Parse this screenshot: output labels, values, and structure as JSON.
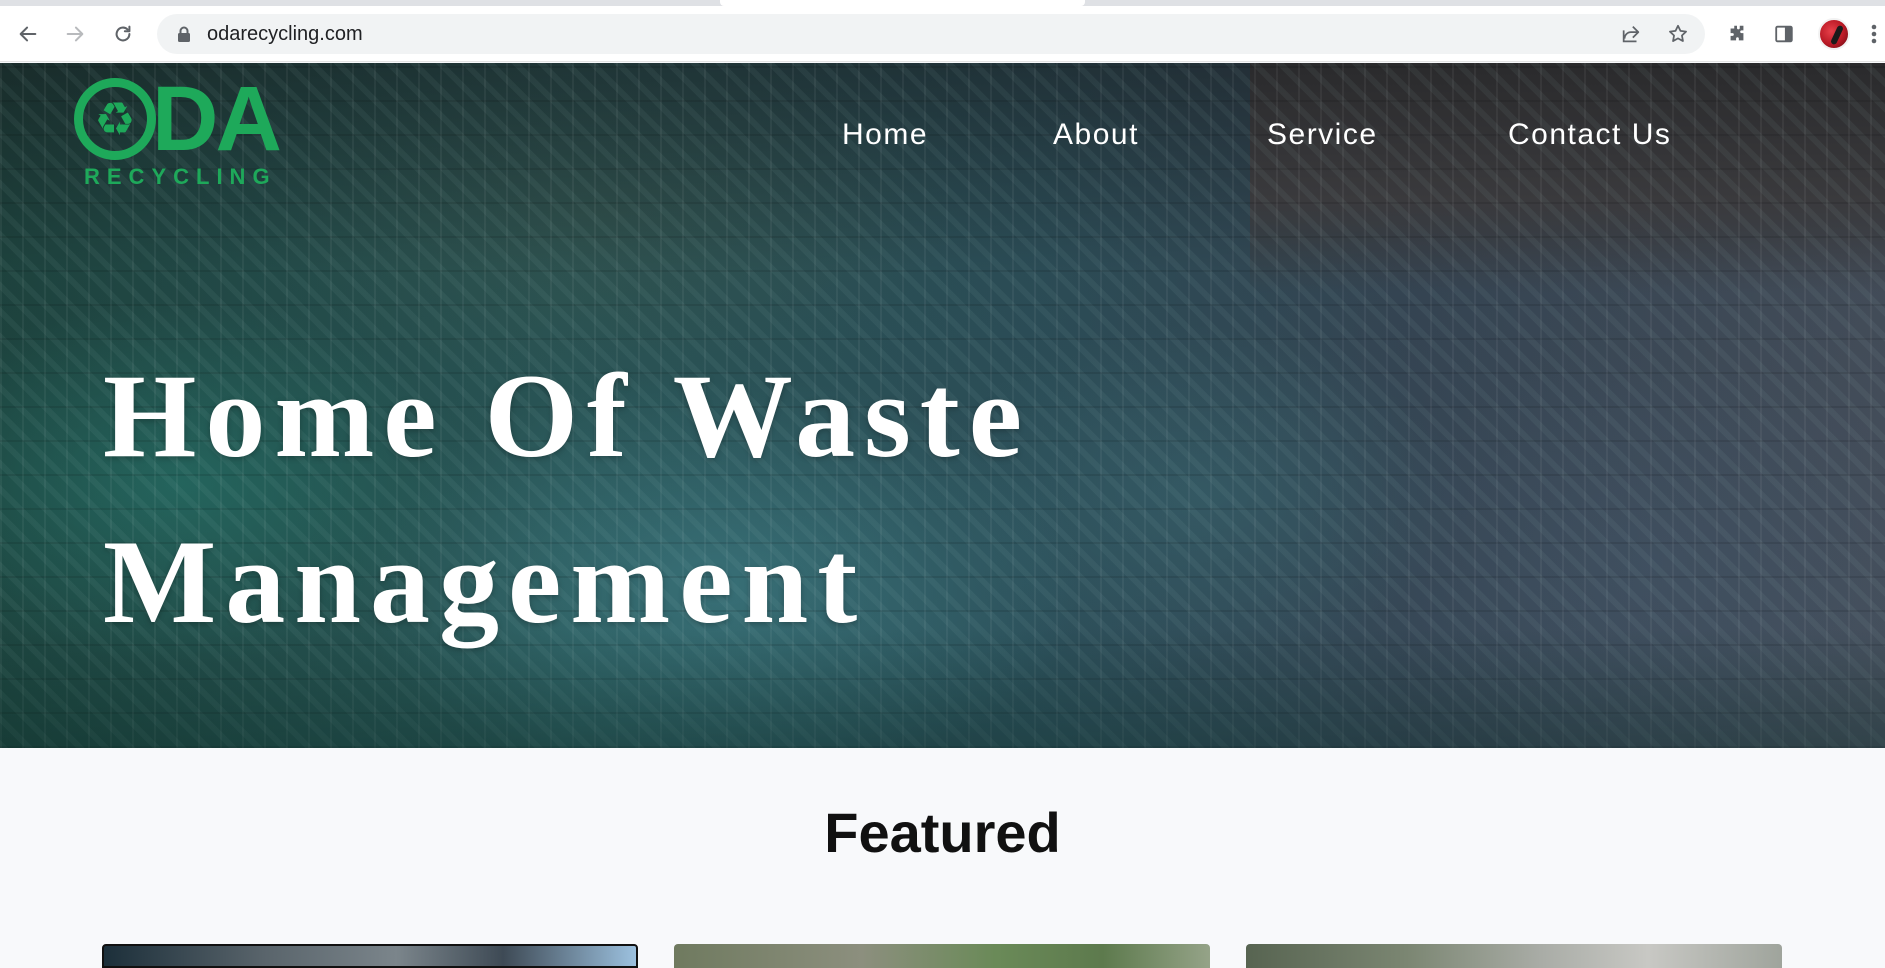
{
  "browser": {
    "url": "odarecycling.com",
    "icons": {
      "back": "arrow-left-icon",
      "forward": "arrow-right-icon",
      "reload": "reload-icon",
      "lock": "lock-icon",
      "share": "share-icon",
      "bookmark": "star-icon",
      "extensions": "puzzle-icon",
      "side_panel": "side-panel-icon",
      "profile": "avatar",
      "menu": "kebab-menu-icon"
    }
  },
  "site": {
    "logo": {
      "letters": "DA",
      "subtitle": "RECYCLING",
      "color": "#1ea95a"
    },
    "nav": [
      {
        "label": "Home"
      },
      {
        "label": "About"
      },
      {
        "label": "Service"
      },
      {
        "label": "Contact Us"
      }
    ],
    "hero": {
      "title_line1": "Home Of Waste",
      "title_line2": "Management"
    },
    "featured": {
      "heading": "Featured",
      "cards": [
        {
          "name": "featured-card-1"
        },
        {
          "name": "featured-card-2"
        },
        {
          "name": "featured-card-3"
        }
      ]
    }
  }
}
